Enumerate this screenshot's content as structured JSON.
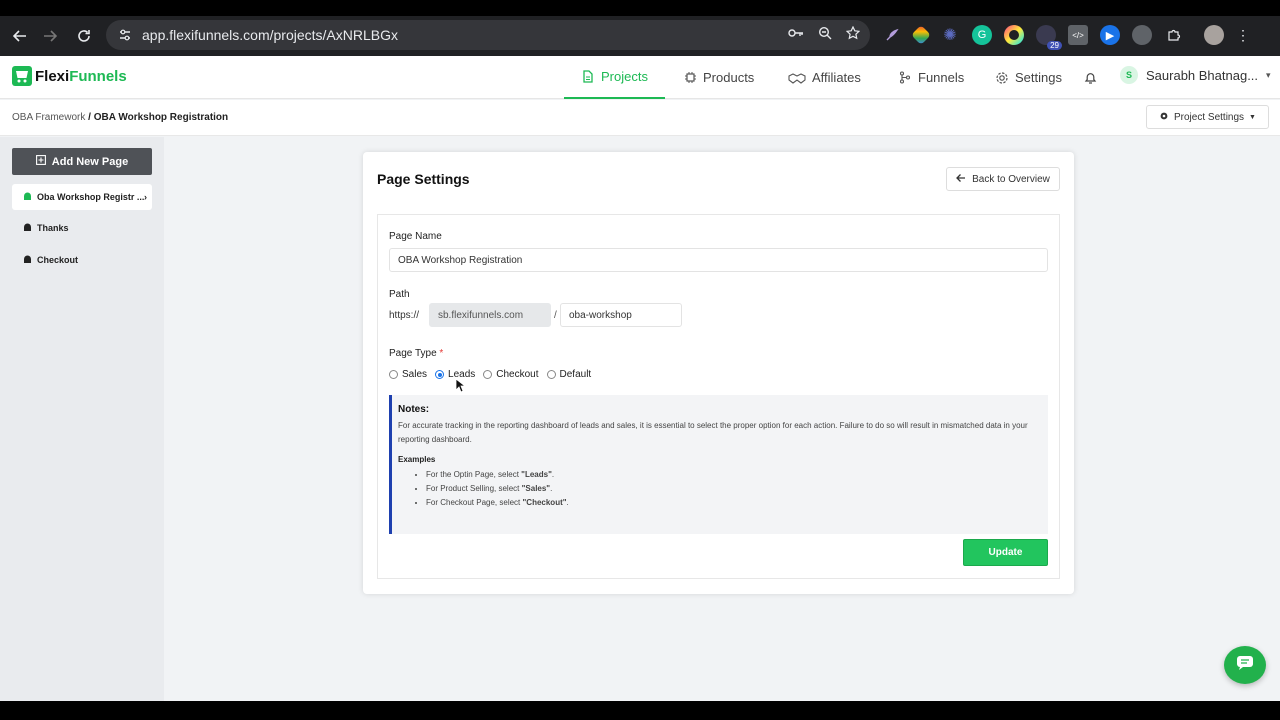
{
  "browser": {
    "url": "app.flexifunnels.com/projects/AxNRLBGx",
    "ext_badge": "29"
  },
  "app": {
    "logo_part1": "Flexi",
    "logo_part2": "Funnels",
    "nav": [
      {
        "label": "Projects"
      },
      {
        "label": "Products"
      },
      {
        "label": "Affiliates"
      },
      {
        "label": "Funnels"
      },
      {
        "label": "Settings"
      }
    ],
    "user_initial": "S",
    "user_name": "Saurabh Bhatnag..."
  },
  "breadcrumb": {
    "parent": "OBA Framework",
    "current": "/ OBA Workshop Registration"
  },
  "project_settings_label": "Project Settings",
  "sidebar": {
    "add_label": "Add New Page",
    "items": [
      {
        "label": "Oba Workshop Registr ..."
      },
      {
        "label": "Thanks"
      },
      {
        "label": "Checkout"
      }
    ]
  },
  "page_settings": {
    "title": "Page Settings",
    "back_label": "Back to Overview",
    "page_name_label": "Page Name",
    "page_name_value": "OBA Workshop Registration",
    "path_label": "Path",
    "path_prefix": "https://",
    "path_domain": "sb.flexifunnels.com",
    "path_sep": "/",
    "path_slug": "oba-workshop",
    "page_type_label": "Page Type",
    "page_type_required": "*",
    "page_types": [
      "Sales",
      "Leads",
      "Checkout",
      "Default"
    ],
    "selected_type": "Leads",
    "notes_title": "Notes:",
    "notes_body": "For accurate tracking in the reporting dashboard of leads and sales, it is essential to select the proper option for each action. Failure to do so will result in mismatched data in your reporting dashboard.",
    "examples_title": "Examples",
    "examples": [
      {
        "prefix": "For the Optin Page, select ",
        "value": "\"Leads\"",
        "suffix": "."
      },
      {
        "prefix": "For Product Selling, select ",
        "value": "\"Sales\"",
        "suffix": "."
      },
      {
        "prefix": "For Checkout Page, select ",
        "value": "\"Checkout\"",
        "suffix": "."
      }
    ],
    "update_label": "Update"
  },
  "colors": {
    "brand_green": "#1db954",
    "button_green": "#22c55e",
    "notes_border": "#1e40af"
  }
}
